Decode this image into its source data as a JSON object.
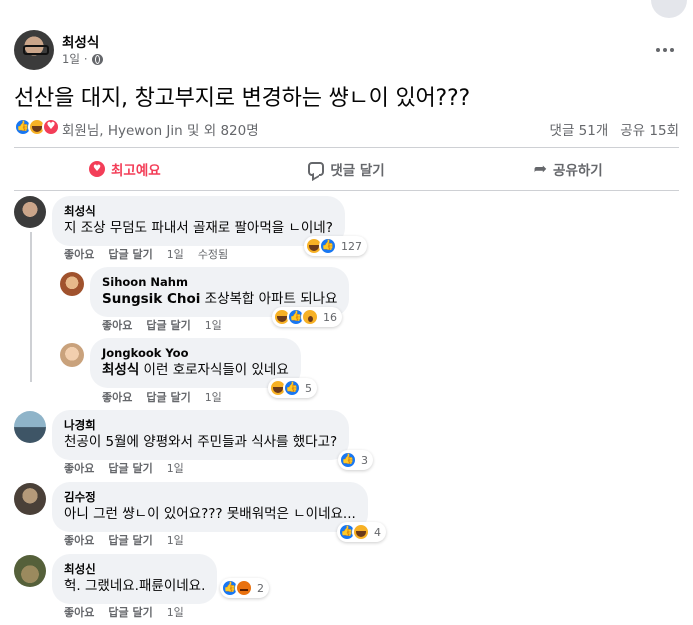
{
  "post": {
    "author": "최성식",
    "time": "1일",
    "text": "선산을 대지, 창고부지로 변경하는 썅ㄴ이 있어???",
    "liked_by": "회원님, Hyewon Jin 및 외 820명",
    "comment_count": "댓글 51개",
    "share_count": "공유 15회"
  },
  "actions": {
    "top": "최고예요",
    "comment": "댓글 달기",
    "share": "공유하기"
  },
  "comment_ui": {
    "like": "좋아요",
    "reply": "답글 달기",
    "edited": "수정됨"
  },
  "comments": [
    {
      "name": "최성식",
      "text": "지 조상 무덤도 파내서 골재로 팔아먹을 ㄴ이네?",
      "time": "1일",
      "reaction_count": "127"
    },
    {
      "name": "Sihoon Nahm",
      "tag": "Sungsik Choi",
      "text": " 조상복합 아파트 되나요",
      "time": "1일",
      "reaction_count": "16"
    },
    {
      "name": "Jongkook Yoo",
      "tag": "최성식",
      "text": " 이런 호로자식들이 있네요",
      "time": "1일",
      "reaction_count": "5"
    },
    {
      "name": "나경희",
      "text": "천공이 5월에 양평와서 주민들과 식사를 했다고?",
      "time": "1일",
      "reaction_count": "3"
    },
    {
      "name": "김수정",
      "text": "아니 그런 썅ㄴ이 있어요??? 못배워먹은 ㄴ이네요...",
      "time": "1일",
      "reaction_count": "4"
    },
    {
      "name": "최성신",
      "text": "헉. 그랬네요.패륜이네요.",
      "time": "1일",
      "reaction_count": "2"
    }
  ],
  "icons": {
    "like": "like-reaction-icon",
    "love": "love-reaction-icon",
    "haha": "haha-reaction-icon",
    "wow": "wow-reaction-icon",
    "angry": "angry-reaction-icon"
  },
  "colors": {
    "like": "#1877f2",
    "love": "#f33e58",
    "haha": "#f7b125",
    "angry": "#e9710f",
    "secondary_text": "#65676b",
    "bubble": "#f0f2f5"
  }
}
